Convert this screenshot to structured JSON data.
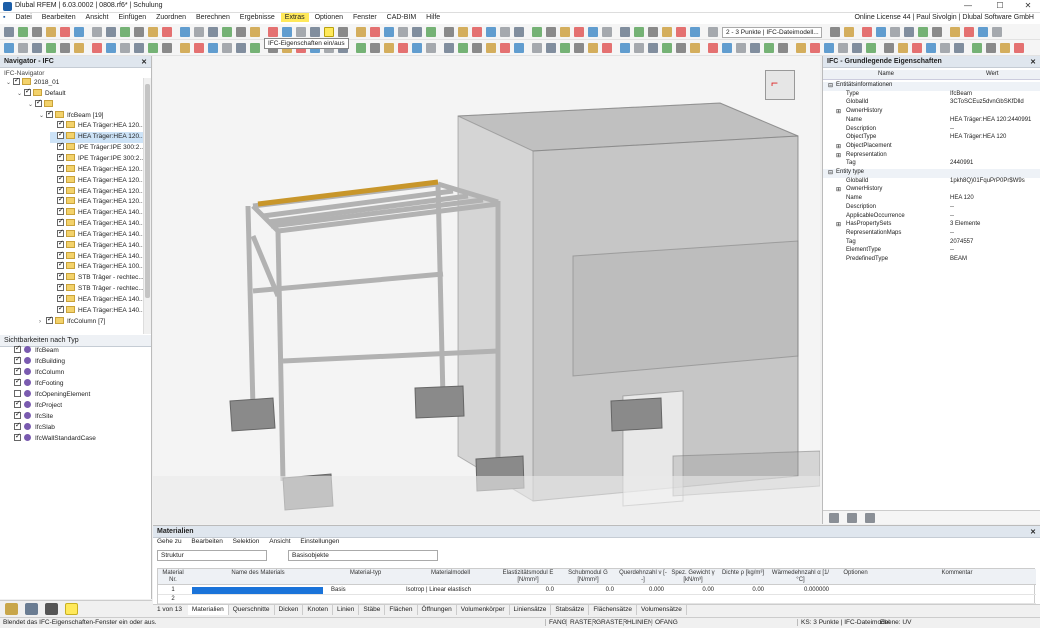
{
  "window": {
    "title": "Dlubal RFEM | 6.03.0002 | 0808.rf6* | Schulung"
  },
  "menu": [
    "Datei",
    "Bearbeiten",
    "Ansicht",
    "Einfügen",
    "Zuordnen",
    "Berechnen",
    "Ergebnisse",
    "Extras",
    "Optionen",
    "Fenster",
    "CAD-BIM",
    "Hilfe"
  ],
  "license": "Online License 44 | Paul Sivolgin | Dlubal Software GmbH",
  "tooltip": "IFC-Eigenschaften ein/aus",
  "toolbar": {
    "combo_model": "2 - 3 Punkte | IFC-Dateimodell..."
  },
  "navigator": {
    "title": "Navigator - IFC",
    "section": "IFC-Navigator",
    "items": [
      {
        "label": "2018_01",
        "level": 0,
        "type": "root",
        "checked": true
      },
      {
        "label": "Default",
        "level": 1,
        "type": "folder",
        "checked": true
      },
      {
        "label": "",
        "level": 2,
        "type": "folder",
        "checked": true
      },
      {
        "label": "IfcBeam [19]",
        "level": 3,
        "type": "folder",
        "checked": true
      },
      {
        "label": "HEA Träger:HEA 120...",
        "level": 4,
        "type": "item",
        "checked": true
      },
      {
        "label": "HEA Träger:HEA 120...",
        "level": 4,
        "type": "item",
        "checked": true,
        "selected": true
      },
      {
        "label": "IPE Träger:IPE 300:2...",
        "level": 4,
        "type": "item",
        "checked": true
      },
      {
        "label": "IPE Träger:IPE 300:2...",
        "level": 4,
        "type": "item",
        "checked": true
      },
      {
        "label": "HEA Träger:HEA 120...",
        "level": 4,
        "type": "item",
        "checked": true
      },
      {
        "label": "HEA Träger:HEA 120...",
        "level": 4,
        "type": "item",
        "checked": true
      },
      {
        "label": "HEA Träger:HEA 120...",
        "level": 4,
        "type": "item",
        "checked": true
      },
      {
        "label": "HEA Träger:HEA 120...",
        "level": 4,
        "type": "item",
        "checked": true
      },
      {
        "label": "HEA Träger:HEA 140...",
        "level": 4,
        "type": "item",
        "checked": true
      },
      {
        "label": "HEA Träger:HEA 140...",
        "level": 4,
        "type": "item",
        "checked": true
      },
      {
        "label": "HEA Träger:HEA 140...",
        "level": 4,
        "type": "item",
        "checked": true
      },
      {
        "label": "HEA Träger:HEA 140...",
        "level": 4,
        "type": "item",
        "checked": true
      },
      {
        "label": "HEA Träger:HEA 140...",
        "level": 4,
        "type": "item",
        "checked": true
      },
      {
        "label": "HEA Träger:HEA 100...",
        "level": 4,
        "type": "item",
        "checked": true
      },
      {
        "label": "STB Träger - rechtec...",
        "level": 4,
        "type": "item",
        "checked": true
      },
      {
        "label": "STB Träger - rechtec...",
        "level": 4,
        "type": "item",
        "checked": true
      },
      {
        "label": "HEA Träger:HEA 140...",
        "level": 4,
        "type": "item",
        "checked": true
      },
      {
        "label": "HEA Träger:HEA 140...",
        "level": 4,
        "type": "item",
        "checked": true
      },
      {
        "label": "IfcColumn [7]",
        "level": 3,
        "type": "folder",
        "checked": true
      }
    ],
    "visibility_title": "Sichtbarkeiten nach Typ",
    "visibility": [
      {
        "label": "IfcBeam",
        "checked": true
      },
      {
        "label": "IfcBuilding",
        "checked": true
      },
      {
        "label": "IfcColumn",
        "checked": true
      },
      {
        "label": "IfcFooting",
        "checked": true
      },
      {
        "label": "IfcOpeningElement",
        "checked": false
      },
      {
        "label": "IfcProject",
        "checked": true
      },
      {
        "label": "IfcSite",
        "checked": true
      },
      {
        "label": "IfcSlab",
        "checked": true
      },
      {
        "label": "IfcWallStandardCase",
        "checked": true
      }
    ]
  },
  "ifc_panel": {
    "title": "IFC - Grundlegende Eigenschaften",
    "col_name": "Name",
    "col_value": "Wert",
    "rows": [
      {
        "name": "Entitätsinformationen",
        "value": "",
        "level": 0,
        "group": true,
        "expander": "-"
      },
      {
        "name": "Type",
        "value": "IfcBeam",
        "level": 1
      },
      {
        "name": "GlobalId",
        "value": "3CToSCEuz5dvnGbSKfDlld",
        "level": 1
      },
      {
        "name": "OwnerHistory",
        "value": "",
        "level": 1,
        "expander": "+"
      },
      {
        "name": "Name",
        "value": "HEA Träger:HEA 120:2440991",
        "level": 1
      },
      {
        "name": "Description",
        "value": "--",
        "level": 1
      },
      {
        "name": "ObjectType",
        "value": "HEA Träger:HEA 120",
        "level": 1
      },
      {
        "name": "ObjectPlacement",
        "value": "",
        "level": 1,
        "expander": "+"
      },
      {
        "name": "Representation",
        "value": "",
        "level": 1,
        "expander": "+"
      },
      {
        "name": "Tag",
        "value": "2440991",
        "level": 1
      },
      {
        "name": "Entity type",
        "value": "",
        "level": 0,
        "group": true,
        "expander": "-"
      },
      {
        "name": "GlobalId",
        "value": "1pkh8Q)01FquPrP0Pr$W9s",
        "level": 1
      },
      {
        "name": "OwnerHistory",
        "value": "",
        "level": 1,
        "expander": "+"
      },
      {
        "name": "Name",
        "value": "HEA 120",
        "level": 1
      },
      {
        "name": "Description",
        "value": "--",
        "level": 1
      },
      {
        "name": "ApplicableOccurrence",
        "value": "--",
        "level": 1
      },
      {
        "name": "HasPropertySets",
        "value": "3 Elemente",
        "level": 1,
        "expander": "+"
      },
      {
        "name": "RepresentationMaps",
        "value": "--",
        "level": 1
      },
      {
        "name": "Tag",
        "value": "2074557",
        "level": 1
      },
      {
        "name": "ElementType",
        "value": "--",
        "level": 1
      },
      {
        "name": "PredefinedType",
        "value": "BEAM",
        "level": 1
      }
    ]
  },
  "materials": {
    "title": "Materialien",
    "menu": [
      "Gehe zu",
      "Bearbeiten",
      "Selektion",
      "Ansicht",
      "Einstellungen"
    ],
    "combo_left": "Struktur",
    "combo_right": "Basisobjekte",
    "headers": [
      "Material Nr.",
      "Name des Materials",
      "Material-typ",
      "Materialmodell",
      "Elastizitätsmodul E [N/mm²]",
      "Schubmodul G [N/mm²]",
      "Querdehnzahl ν [--]",
      "Spez. Gewicht γ [kN/m³]",
      "Dichte ρ [kg/m³]",
      "Wärmedehnzahl α [1/°C]",
      "Optionen",
      "Kommentar"
    ],
    "rows": [
      {
        "nr": "1",
        "name": "",
        "type": "Basis",
        "model": "Isotrop | Linear elastisch",
        "e": "0.0",
        "g": "0.0",
        "nu": "0.000",
        "gamma": "0.00",
        "rho": "0.00",
        "alpha": "0.000000"
      },
      {
        "nr": "2",
        "name": "",
        "type": "",
        "model": "",
        "e": "",
        "g": "",
        "nu": "",
        "gamma": "",
        "rho": "",
        "alpha": ""
      }
    ],
    "pager": "1 von 13",
    "tabs": [
      "Materialien",
      "Querschnitte",
      "Dicken",
      "Knoten",
      "Linien",
      "Stäbe",
      "Flächen",
      "Öffnungen",
      "Volumenkörper",
      "Liniensätze",
      "Stabsätze",
      "Flächensätze",
      "Volumensätze"
    ],
    "active_tab": "Materialien"
  },
  "status": {
    "message": "Blendet das IFC-Eigenschaften-Fenster ein oder aus.",
    "toggles": [
      "FANG",
      "RASTER",
      "GRASTER",
      "HLINIEN",
      "OFANG"
    ],
    "cs": "KS: 3 Punkte | IFC-Dateimodel",
    "plane": "Ebene: UV"
  },
  "viewcube": {
    "face_label": "⌐"
  },
  "colors": {
    "accent": "#ffe95a",
    "selected_beam": "#c8962a",
    "header_bg": "#dfe6ee"
  }
}
